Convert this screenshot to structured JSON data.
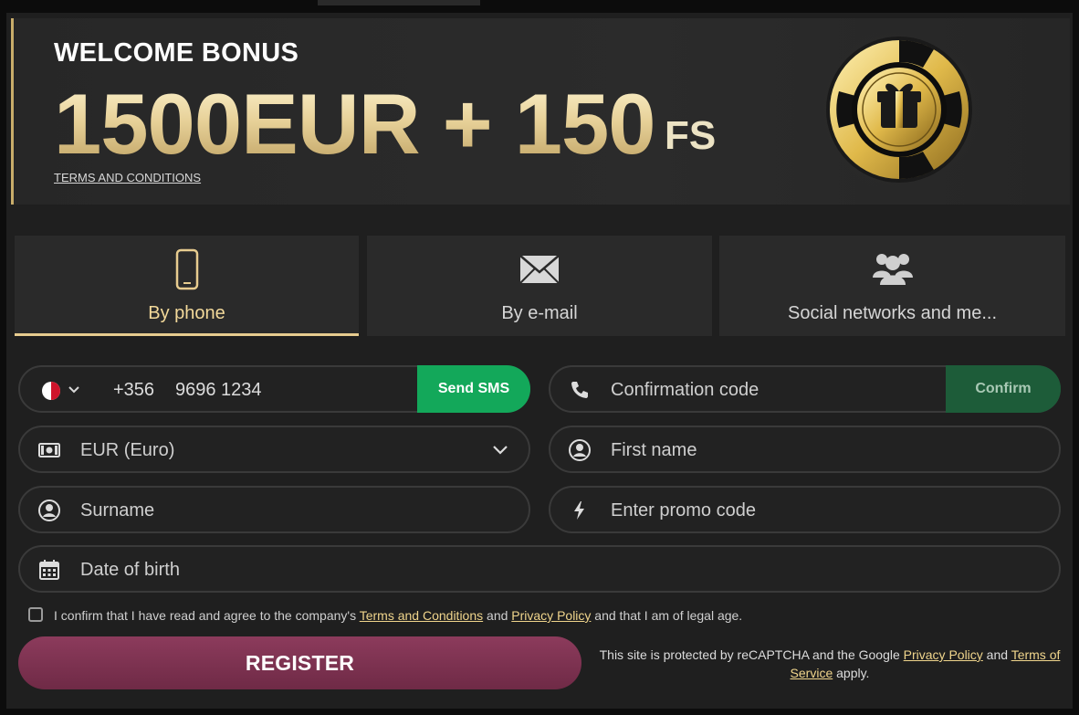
{
  "banner": {
    "welcome": "WELCOME BONUS",
    "amount": "1500EUR + 150",
    "fs": "FS",
    "terms_link": "TERMS AND CONDITIONS"
  },
  "tabs": [
    {
      "label": "By phone",
      "icon": "phone-icon",
      "active": true
    },
    {
      "label": "By e-mail",
      "icon": "envelope-icon",
      "active": false
    },
    {
      "label": "Social networks and me...",
      "icon": "users-icon",
      "active": false
    }
  ],
  "phone": {
    "country_code": "+356",
    "number": "9696 1234",
    "send_sms": "Send SMS"
  },
  "confirmation": {
    "placeholder": "Confirmation code",
    "confirm": "Confirm"
  },
  "currency": {
    "value": "EUR (Euro)"
  },
  "first_name": {
    "placeholder": "First name"
  },
  "surname": {
    "placeholder": "Surname"
  },
  "promo": {
    "placeholder": "Enter promo code"
  },
  "dob": {
    "placeholder": "Date of birth"
  },
  "consent": {
    "prefix": "I confirm that I have read and agree to the company's ",
    "terms": "Terms and Conditions",
    "and": " and ",
    "privacy": "Privacy Policy",
    "suffix": " and that I am of legal age."
  },
  "register": "REGISTER",
  "recaptcha": {
    "prefix": "This site is protected by reCAPTCHA and the Google ",
    "privacy": "Privacy Policy",
    "and": " and ",
    "terms": "Terms of Service",
    "suffix": " apply."
  },
  "colors": {
    "accent_gold": "#e7cc8f",
    "sms_green": "#13a85a",
    "confirm_green": "#1d5c39",
    "register": "#7d3251"
  }
}
